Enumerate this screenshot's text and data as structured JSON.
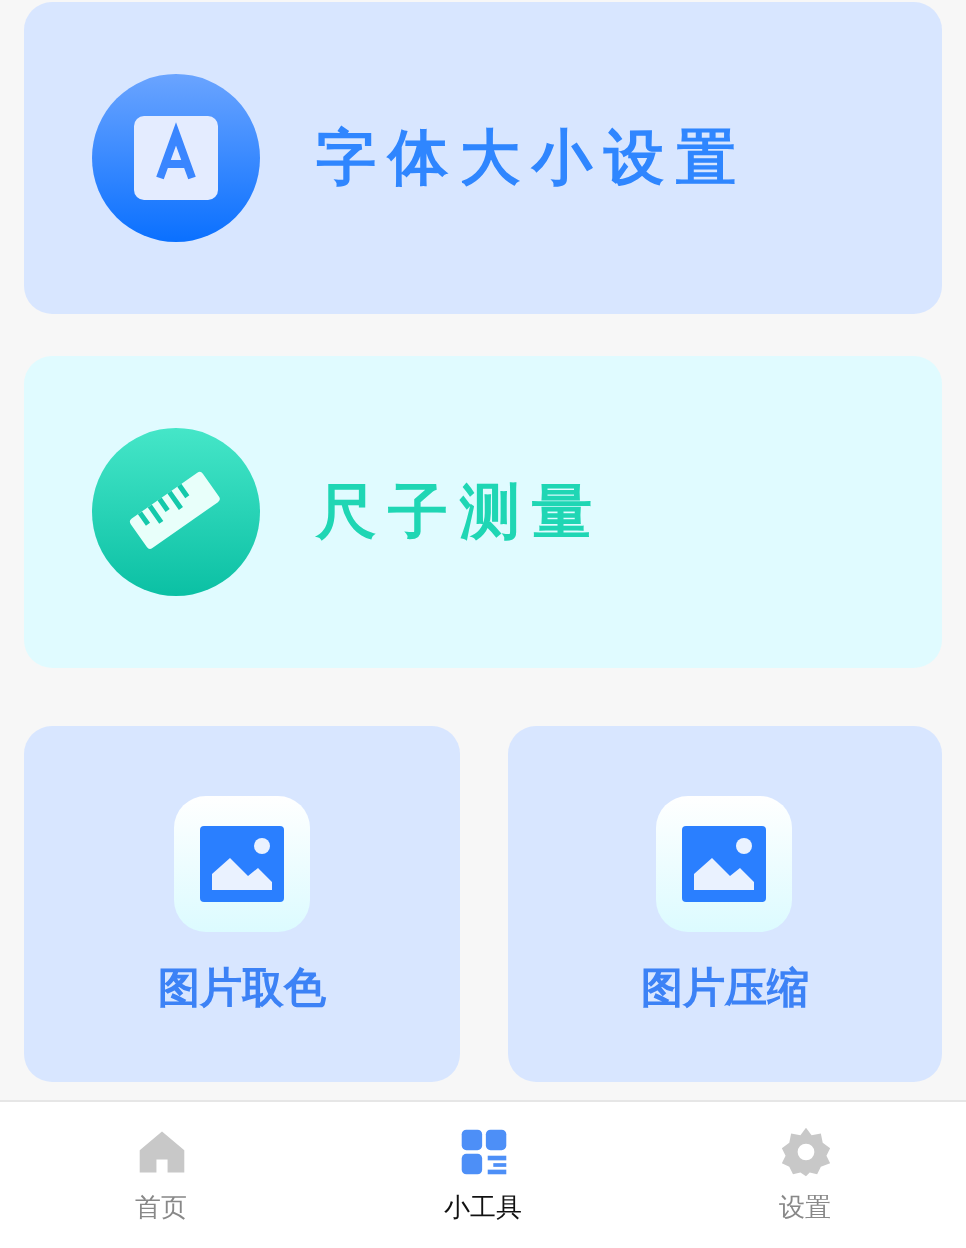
{
  "feature_cards": [
    {
      "kind": "font",
      "title": "字体大小设置",
      "color": "#2f86ff"
    },
    {
      "kind": "ruler",
      "title": "尺子测量",
      "color": "#1fd6b4"
    }
  ],
  "tool_cards": [
    {
      "title": "图片取色"
    },
    {
      "title": "图片压缩"
    }
  ],
  "tabs": [
    {
      "kind": "home",
      "label": "首页",
      "selected": false
    },
    {
      "kind": "tools",
      "label": "小工具",
      "selected": true
    },
    {
      "kind": "settings",
      "label": "设置",
      "selected": false
    }
  ]
}
